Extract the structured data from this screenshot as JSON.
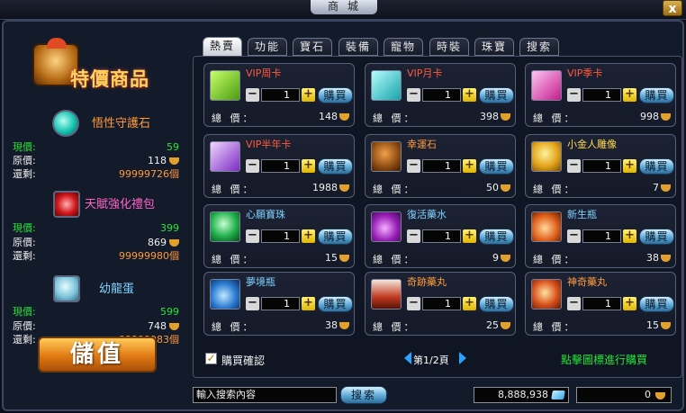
{
  "window": {
    "title": "商城",
    "close_label": "x"
  },
  "left_panel": {
    "banner": "特價商品",
    "featured": [
      {
        "name": "悟性守護石",
        "icon": "cyan-gem-icon",
        "current_price_label": "現價:",
        "current_price": "59",
        "original_price_label": "原價:",
        "original_price": "118",
        "remaining_label": "還剩:",
        "remaining": "99999726個"
      },
      {
        "name": "天賦強化禮包",
        "icon": "red-gift-icon",
        "current_price_label": "現價:",
        "current_price": "399",
        "original_price_label": "原價:",
        "original_price": "869",
        "remaining_label": "還剩:",
        "remaining": "99999980個"
      },
      {
        "name": "幼龍蛋",
        "icon": "dragon-egg-icon",
        "current_price_label": "現價:",
        "current_price": "599",
        "original_price_label": "原價:",
        "original_price": "748",
        "remaining_label": "還剩:",
        "remaining": "99999983個"
      }
    ],
    "recharge_label": "儲值"
  },
  "tabs": [
    {
      "label": "熱賣",
      "active": true
    },
    {
      "label": "功能",
      "active": false
    },
    {
      "label": "寶石",
      "active": false
    },
    {
      "label": "裝備",
      "active": false
    },
    {
      "label": "寵物",
      "active": false
    },
    {
      "label": "時裝",
      "active": false
    },
    {
      "label": "珠寶",
      "active": false
    },
    {
      "label": "搜索",
      "active": false
    }
  ],
  "products": [
    {
      "name": "VIP周卡",
      "icon": "vip-week-card-icon",
      "qty": "1",
      "buy_label": "購買",
      "total_label": "總 價：",
      "total": "148"
    },
    {
      "name": "VIP月卡",
      "icon": "vip-month-card-icon",
      "qty": "1",
      "buy_label": "購買",
      "total_label": "總 價：",
      "total": "398"
    },
    {
      "name": "VIP季卡",
      "icon": "vip-season-card-icon",
      "qty": "1",
      "buy_label": "購買",
      "total_label": "總 價：",
      "total": "998"
    },
    {
      "name": "VIP半年卡",
      "icon": "vip-halfyear-card-icon",
      "qty": "1",
      "buy_label": "購買",
      "total_label": "總 價：",
      "total": "1988"
    },
    {
      "name": "幸運石",
      "icon": "lucky-stone-icon",
      "qty": "1",
      "buy_label": "購買",
      "total_label": "總 價：",
      "total": "50"
    },
    {
      "name": "小金人雕像",
      "icon": "gold-statue-icon",
      "qty": "1",
      "buy_label": "購買",
      "total_label": "總 價：",
      "total": "7"
    },
    {
      "name": "心願寶珠",
      "icon": "wish-orb-icon",
      "qty": "1",
      "buy_label": "購買",
      "total_label": "總 價：",
      "total": "15"
    },
    {
      "name": "復活藥水",
      "icon": "revive-potion-icon",
      "qty": "1",
      "buy_label": "購買",
      "total_label": "總 價：",
      "total": "9"
    },
    {
      "name": "新生瓶",
      "icon": "rebirth-bottle-icon",
      "qty": "1",
      "buy_label": "購買",
      "total_label": "總 價：",
      "total": "38"
    },
    {
      "name": "夢境瓶",
      "icon": "dream-bottle-icon",
      "qty": "1",
      "buy_label": "購買",
      "total_label": "總 價：",
      "total": "38"
    },
    {
      "name": "奇跡藥丸",
      "icon": "miracle-pill-icon",
      "qty": "1",
      "buy_label": "購買",
      "total_label": "總 價：",
      "total": "25"
    },
    {
      "name": "神奇藥丸",
      "icon": "magic-pill-icon",
      "qty": "1",
      "buy_label": "購買",
      "total_label": "總 價：",
      "total": "15"
    }
  ],
  "footer": {
    "confirm_label": "購買確認",
    "page_text": "第1/2頁",
    "hint": "點擊圖標進行購買"
  },
  "bottom": {
    "search_placeholder": "輸入搜索內容",
    "search_button": "搜索",
    "gems": "8,888,938",
    "coins": "0"
  }
}
